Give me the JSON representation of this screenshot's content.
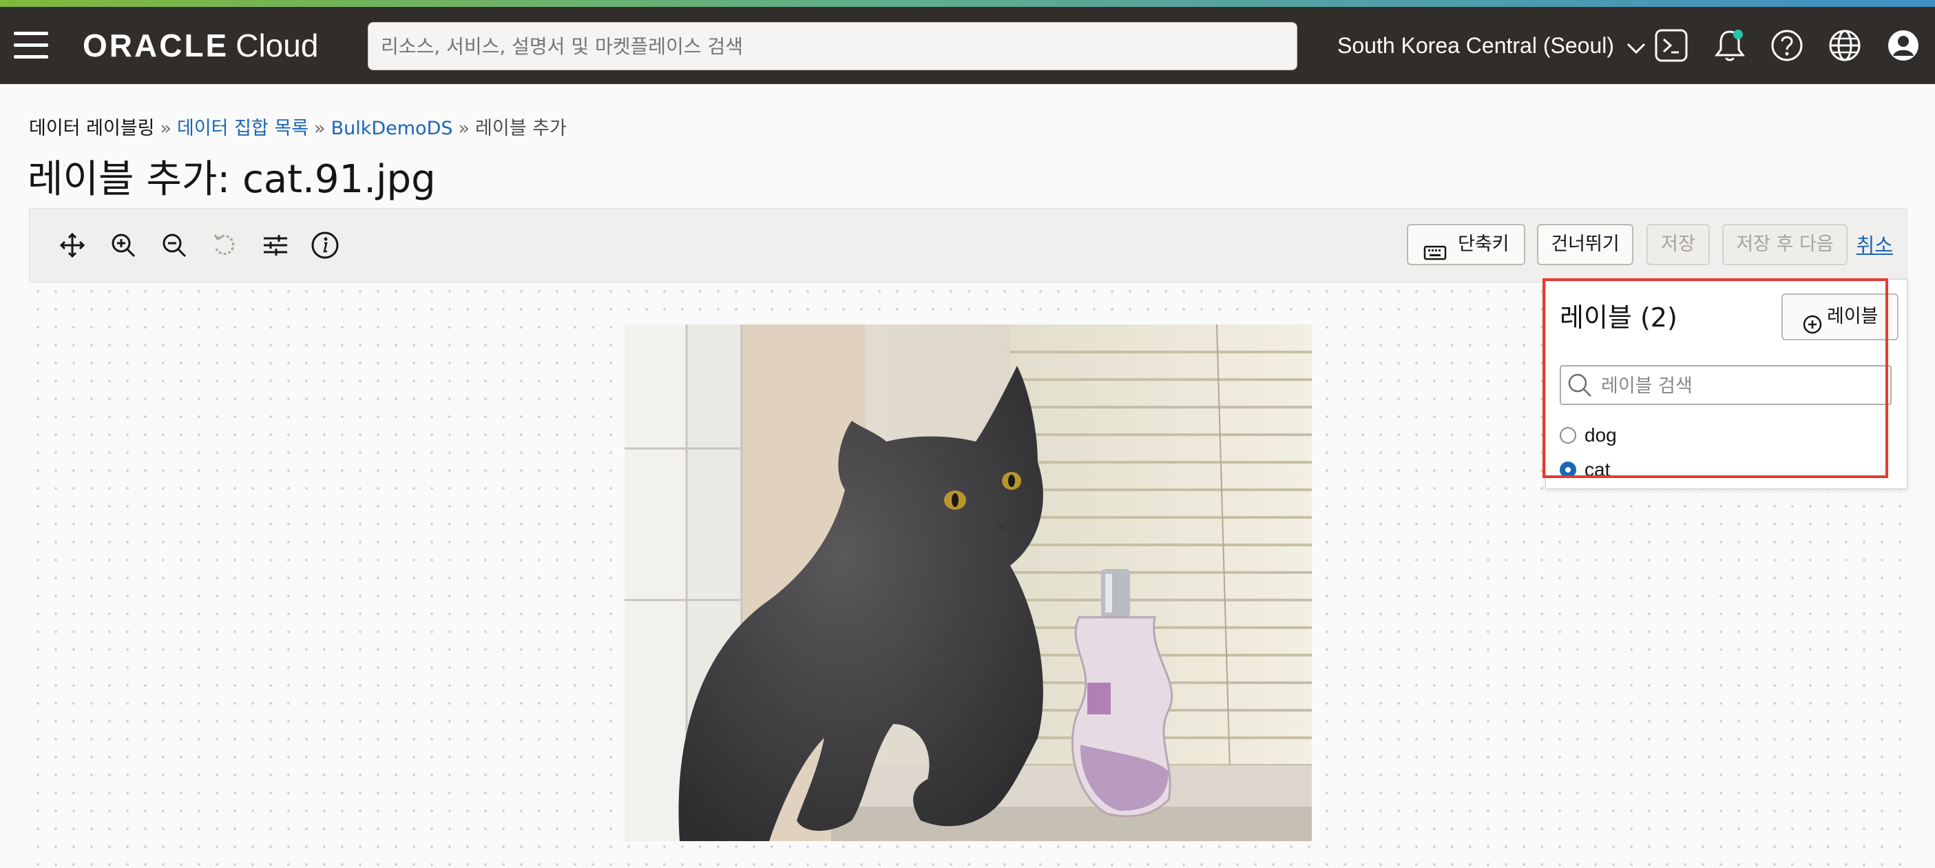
{
  "header": {
    "brand": "ORACLE",
    "product": "Cloud",
    "search_placeholder": "리소스, 서비스, 설명서 및 마켓플레이스 검색",
    "region": "South Korea Central (Seoul)",
    "icons": [
      "cloud-shell-icon",
      "notifications-bell-icon",
      "help-icon",
      "language-globe-icon",
      "user-profile-icon"
    ]
  },
  "breadcrumb": {
    "items": [
      {
        "label": "데이터 레이블링",
        "link": false
      },
      {
        "label": "데이터 집합 목록",
        "link": true
      },
      {
        "label": "BulkDemoDS",
        "link": true
      },
      {
        "label": "레이블 추가",
        "link": false
      }
    ],
    "separator": "»"
  },
  "page": {
    "title": "레이블 추가: cat.91.jpg"
  },
  "toolbar": {
    "tools": [
      "move-icon",
      "zoom-in-icon",
      "zoom-out-icon",
      "reset-icon",
      "adjust-icon",
      "info-icon"
    ],
    "shortcuts_label": "단축키",
    "skip_label": "건너뛰기",
    "save_label": "저장",
    "save_next_label": "저장 후 다음",
    "cancel_label": "취소"
  },
  "label_panel": {
    "title": "레이블 (2)",
    "add_button_label": "레이블",
    "search_placeholder": "레이블 검색",
    "options": [
      {
        "label": "dog",
        "selected": false
      },
      {
        "label": "cat",
        "selected": true
      }
    ]
  },
  "colors": {
    "header_bg": "#312d2a",
    "link": "#1b66b5",
    "highlight": "#e53b30",
    "radio_selected": "#1b66b5"
  }
}
